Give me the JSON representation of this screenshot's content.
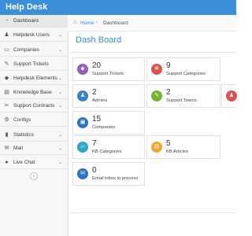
{
  "app": {
    "title": "Help Desk"
  },
  "sidebar": {
    "items": [
      {
        "label": "Dashboard",
        "icon": "dashboard-icon",
        "glyph": "◔",
        "has_submenu": false
      },
      {
        "label": "Helpdesk Users",
        "icon": "users-icon",
        "glyph": "♟",
        "has_submenu": true
      },
      {
        "label": "Companies",
        "icon": "companies-icon",
        "glyph": "▭",
        "has_submenu": true
      },
      {
        "label": "Support Tickets",
        "icon": "ticket-icon",
        "glyph": "✎",
        "has_submenu": false
      },
      {
        "label": "Helpdesk Elements",
        "icon": "tags-icon",
        "glyph": "◆",
        "has_submenu": true
      },
      {
        "label": "Knowledge Base",
        "icon": "book-icon",
        "glyph": "▤",
        "has_submenu": true
      },
      {
        "label": "Support Contracts",
        "icon": "wrench-icon",
        "glyph": "✂",
        "has_submenu": true
      },
      {
        "label": "Configs",
        "icon": "gear-icon",
        "glyph": "⚙",
        "has_submenu": false
      },
      {
        "label": "Statistics",
        "icon": "bar-chart-icon",
        "glyph": "▮",
        "has_submenu": true
      },
      {
        "label": "Mail",
        "icon": "envelope-icon",
        "glyph": "✉",
        "has_submenu": true
      },
      {
        "label": "Live Chat",
        "icon": "chat-icon",
        "glyph": "●",
        "has_submenu": true
      }
    ],
    "collapse_glyph": "«",
    "chevron_glyph": "⌄"
  },
  "breadcrumb": {
    "home": "Home",
    "separator": "›",
    "current": "Dashboard",
    "home_glyph": "⌂"
  },
  "page": {
    "title": "Dash Board"
  },
  "cards": [
    {
      "count": "20",
      "label": "Support Tickets",
      "icon": "tags-icon",
      "glyph": "◆",
      "color": "#8e5ec7"
    },
    {
      "count": "9",
      "label": "Support Categories",
      "icon": "gear-icon",
      "glyph": "✻",
      "color": "#e0504d"
    },
    {
      "count": "2",
      "label": "Admins",
      "icon": "admin-user-icon",
      "glyph": "♟",
      "color": "#3b7fd0"
    },
    {
      "count": "2",
      "label": "Support Teams",
      "icon": "teams-icon",
      "glyph": "✎",
      "color": "#78b52b"
    },
    {
      "count": "",
      "label": "",
      "icon": "user-icon",
      "glyph": "♟",
      "color": "#e0504d"
    },
    {
      "count": "15",
      "label": "Companies",
      "icon": "briefcase-icon",
      "glyph": "▣",
      "color": "#2d73c1"
    },
    {
      "count": "7",
      "label": "KB Categories",
      "icon": "folder-icon",
      "glyph": "▱",
      "color": "#2aa7c2"
    },
    {
      "count": "5",
      "label": "KB Articles",
      "icon": "article-icon",
      "glyph": "▤",
      "color": "#eba92f"
    },
    {
      "count": "0",
      "label": "Email inbox to process",
      "icon": "inbox-icon",
      "glyph": "✉",
      "color": "#2d73c1"
    }
  ]
}
